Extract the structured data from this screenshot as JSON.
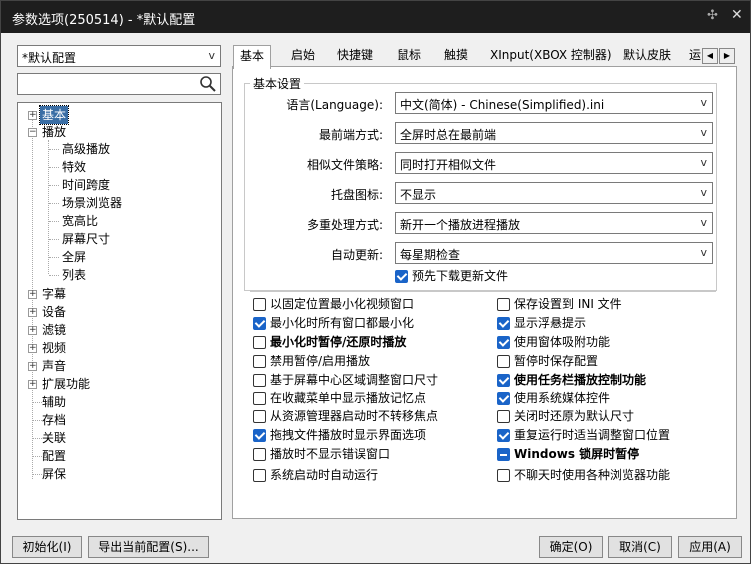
{
  "window": {
    "title": "参数选项(250514) - *默认配置"
  },
  "preset": {
    "value": "*默认配置"
  },
  "search": {
    "placeholder": ""
  },
  "tree": {
    "basic": "基本",
    "playback": "播放",
    "playback_children": [
      "高级播放",
      "特效",
      "时间跨度",
      "场景浏览器",
      "宽高比",
      "屏幕尺寸",
      "全屏",
      "列表"
    ],
    "subtitle": "字幕",
    "device": "设备",
    "filter": "滤镜",
    "video": "视频",
    "audio": "声音",
    "extensions": "扩展功能",
    "assist": "辅助",
    "archive": "存档",
    "association": "关联",
    "config": "配置",
    "screensaver": "屏保"
  },
  "tabs": [
    "基本",
    "启始",
    "快捷键",
    "鼠标",
    "触摸",
    "XInput(XBOX 控制器)",
    "默认皮肤",
    "运"
  ],
  "basic": {
    "group_title": "基本设置",
    "fields": [
      {
        "label": "语言(Language):",
        "value": "中文(简体) - Chinese(Simplified).ini"
      },
      {
        "label": "最前端方式:",
        "value": "全屏时总在最前端"
      },
      {
        "label": "相似文件策略:",
        "value": "同时打开相似文件"
      },
      {
        "label": "托盘图标:",
        "value": "不显示"
      },
      {
        "label": "多重处理方式:",
        "value": "新开一个播放进程播放"
      },
      {
        "label": "自动更新:",
        "value": "每星期检查"
      }
    ],
    "predownload": "预先下载更新文件"
  },
  "options_left": [
    "以固定位置最小化视频窗口",
    "最小化时所有窗口都最小化",
    "最小化时暂停/还原时播放",
    "禁用暂停/启用播放",
    "基于屏幕中心区域调整窗口尺寸",
    "在收藏菜单中显示播放记忆点",
    "从资源管理器启动时不转移焦点",
    "拖拽文件播放时显示界面选项",
    "播放时不显示错误窗口",
    "系统启动时自动运行"
  ],
  "options_right": [
    "保存设置到 INI 文件",
    "显示浮悬提示",
    "使用窗体吸附功能",
    "暂停时保存配置",
    "使用任务栏播放控制功能",
    "使用系统媒体控件",
    "关闭时还原为默认尺寸",
    "重复运行时适当调整窗口位置",
    "Windows 锁屏时暂停",
    "不聊天时使用各种浏览器功能"
  ],
  "buttons": {
    "init": "初始化(I)",
    "export": "导出当前配置(S)...",
    "ok": "确定(O)",
    "cancel": "取消(C)",
    "apply": "应用(A)"
  },
  "colors": {
    "accent": "#1a64c8",
    "titlebar": "#1e1e1e",
    "selection": "#3a6ea5"
  }
}
